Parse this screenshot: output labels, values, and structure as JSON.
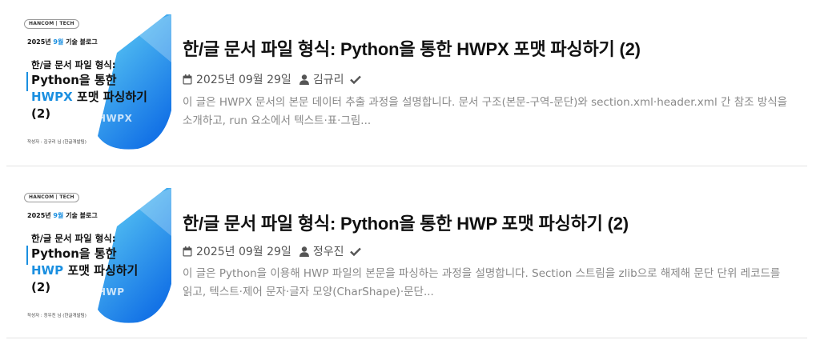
{
  "posts": [
    {
      "thumbnail": {
        "badge": "HANCOM | TECH",
        "series_prefix": "2025년 ",
        "series_month": "9월",
        "series_suffix": " 기술 블로그",
        "heading": "한/글 문서 파일 형식:",
        "line1": "Python을 통한",
        "line2_highlight": "HWPX",
        "line2_rest": " 포맷 파싱하기",
        "line3": "(2)",
        "format_label": "HWPX",
        "author_note": "작성자 : 김규리 님 (한글개발팀)"
      },
      "title": "한/글 문서 파일 형식: Python을 통한 HWPX 포맷 파싱하기 (2)",
      "date": "2025년 09월 29일",
      "author": "김규리",
      "excerpt": "이 글은 HWPX 문서의 본문 데이터 추출 과정을 설명합니다. 문서 구조(본문-구역-문단)와 section.xml·header.xml 간 참조 방식을 소개하고, run 요소에서 텍스트·표·그림..."
    },
    {
      "thumbnail": {
        "badge": "HANCOM | TECH",
        "series_prefix": "2025년 ",
        "series_month": "9월",
        "series_suffix": " 기술 블로그",
        "heading": "한/글 문서 파일 형식:",
        "line1": "Python을 통한",
        "line2_highlight": "HWP",
        "line2_rest": " 포맷 파싱하기",
        "line3": "(2)",
        "format_label": "HWP",
        "author_note": "작성자 : 정우진 님 (한글개발팀)"
      },
      "title": "한/글 문서 파일 형식: Python을 통한 HWP 포맷 파싱하기 (2)",
      "date": "2025년 09월 29일",
      "author": "정우진",
      "excerpt": "이 글은 Python을 이용해 HWP 파일의 본문을 파싱하는 과정을 설명합니다. Section 스트림을 zlib으로 해제해 문단 단위 레코드를 읽고, 텍스트·제어 문자·글자 모양(CharShape)·문단..."
    }
  ],
  "icons": {
    "date": "calendar-icon",
    "author": "user-icon",
    "verified": "check-icon"
  },
  "colors": {
    "accent": "#1a8fe0",
    "gradient_light": "#63d3f5",
    "gradient_dark": "#1473e6",
    "title": "#111111",
    "meta": "#555555",
    "excerpt": "#888888"
  }
}
